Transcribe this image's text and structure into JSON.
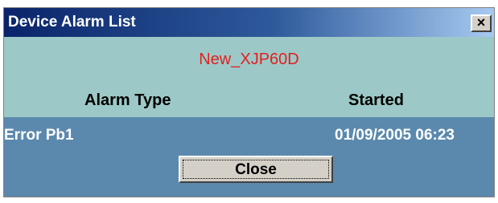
{
  "window": {
    "title": "Device Alarm List",
    "close_glyph": "×",
    "close_icon": "close-icon"
  },
  "device": {
    "name": "New_XJP60D",
    "name_color": "#e41e1e"
  },
  "table": {
    "columns": [
      "Alarm Type",
      "Started"
    ],
    "rows": [
      [
        "Error Pb1",
        "01/09/2005 06:23"
      ]
    ]
  },
  "buttons": {
    "close_label": "Close"
  },
  "colors": {
    "title_bar": "#0a246a",
    "header_bg": "#9cc9c7",
    "row_bg": "#5b89ad",
    "dialog_face": "#d4d0c8"
  }
}
